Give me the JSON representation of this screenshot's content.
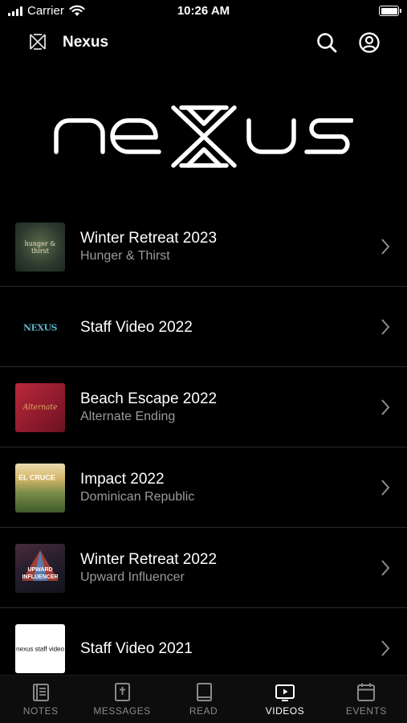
{
  "status_bar": {
    "carrier": "Carrier",
    "time": "10:26 AM"
  },
  "nav": {
    "title": "Nexus",
    "icons": [
      "nexus-logo-icon",
      "search-icon",
      "account-icon"
    ]
  },
  "brand": {
    "wordmark": "nexus"
  },
  "videos": [
    {
      "title": "Winter Retreat 2023",
      "subtitle": "Hunger & Thirst",
      "thumb_text": "hunger & thirst"
    },
    {
      "title": "Staff Video 2022",
      "subtitle": "",
      "thumb_text": "NEXUS"
    },
    {
      "title": "Beach Escape 2022",
      "subtitle": "Alternate Ending",
      "thumb_text": "Alternate"
    },
    {
      "title": "Impact 2022",
      "subtitle": "Dominican Republic",
      "thumb_text": "EL CRUCE"
    },
    {
      "title": "Winter Retreat 2022",
      "subtitle": "Upward Influencer",
      "thumb_text": "UPWARD INFLUENCER"
    },
    {
      "title": "Staff Video 2021",
      "subtitle": "",
      "thumb_text": "nexus staff video"
    }
  ],
  "tabs": [
    {
      "label": "NOTES",
      "icon": "notes-icon",
      "active": false
    },
    {
      "label": "MESSAGES",
      "icon": "bible-icon",
      "active": false
    },
    {
      "label": "READ",
      "icon": "book-icon",
      "active": false
    },
    {
      "label": "VIDEOS",
      "icon": "video-icon",
      "active": true
    },
    {
      "label": "EVENTS",
      "icon": "calendar-icon",
      "active": false
    }
  ]
}
